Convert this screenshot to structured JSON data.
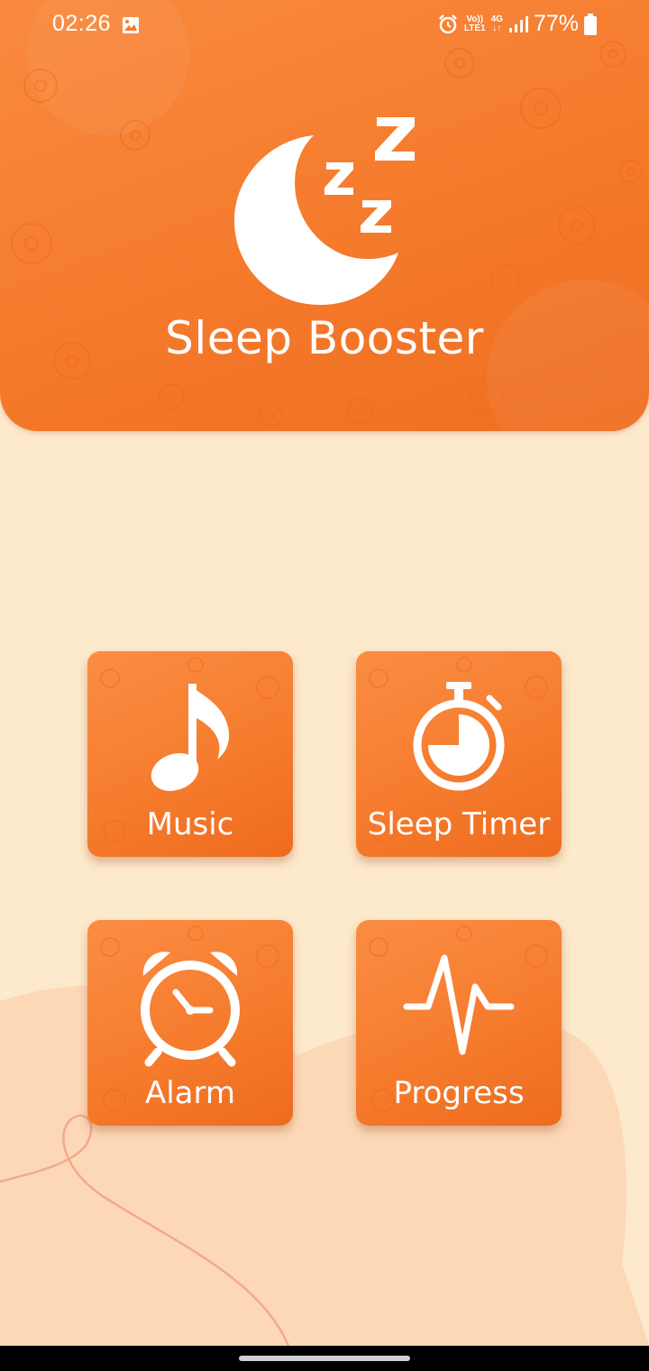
{
  "status_bar": {
    "time": "02:26",
    "network_volte": "Vo))",
    "network_lte": "LTE1",
    "network_type": "4G",
    "battery": "77%"
  },
  "app": {
    "title": "Sleep Booster",
    "logo_icon": "moon-zzz-icon"
  },
  "tiles": [
    {
      "label": "Music",
      "icon": "music-note-icon"
    },
    {
      "label": "Sleep Timer",
      "icon": "stopwatch-icon"
    },
    {
      "label": "Alarm",
      "icon": "alarm-clock-icon"
    },
    {
      "label": "Progress",
      "icon": "pulse-line-icon"
    }
  ],
  "colors": {
    "primary": "#f57a2c",
    "background": "#fde9cc",
    "text_on_primary": "#ffffff"
  }
}
